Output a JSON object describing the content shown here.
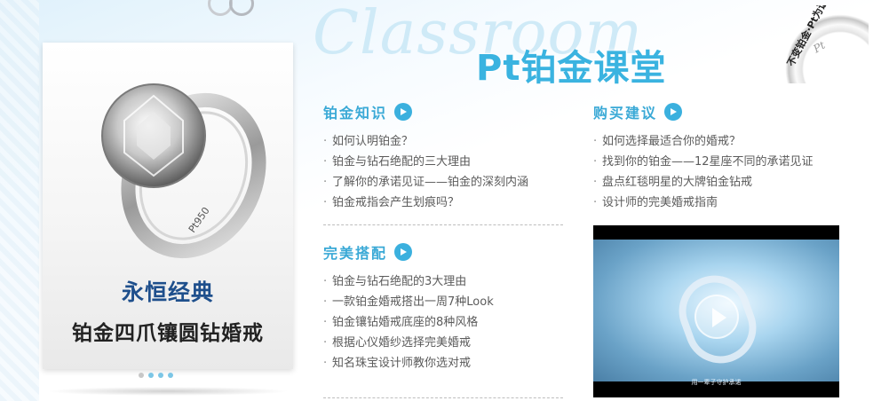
{
  "header": {
    "script_word": "Classroom",
    "title": "Pt铂金课堂",
    "seal_text": "不变铂金·Pt为证",
    "seal_mark": "Pt"
  },
  "banner": {
    "title": "永恒经典",
    "subtitle": "铂金四爪镶圆钻婚戒",
    "ring_engraving": "Pt950",
    "slides": 4,
    "active_slide": 1
  },
  "sections": {
    "knowledge": {
      "title": "铂金知识",
      "items": [
        "如何认明铂金？",
        "铂金与钻石绝配的三大理由",
        "了解你的承诺见证——铂金的深刻内涵",
        "铂金戒指会产生划痕吗？"
      ]
    },
    "matching": {
      "title": "完美搭配",
      "items": [
        "铂金与钻石绝配的3大理由",
        "一款铂金婚戒搭出一周7种Look",
        "铂金镶钻婚戒底座的8种风格",
        "根据心仪婚纱选择完美婚戒",
        "知名珠宝设计师教你选对戒"
      ]
    },
    "buying": {
      "title": "购买建议",
      "items": [
        "如何选择最适合你的婚戒？",
        "找到你的铂金——12星座不同的承诺见证",
        "盘点红毯明星的大牌铂金钻戒",
        "设计师的完美婚戒指南"
      ]
    }
  },
  "video": {
    "caption": "用一辈子守护承诺"
  },
  "colors": {
    "accent": "#3ab3e0",
    "banner_title": "#1e4f8c",
    "link_text": "#5b5b5b"
  },
  "icons": [
    "arrow-right-icon",
    "play-icon"
  ]
}
